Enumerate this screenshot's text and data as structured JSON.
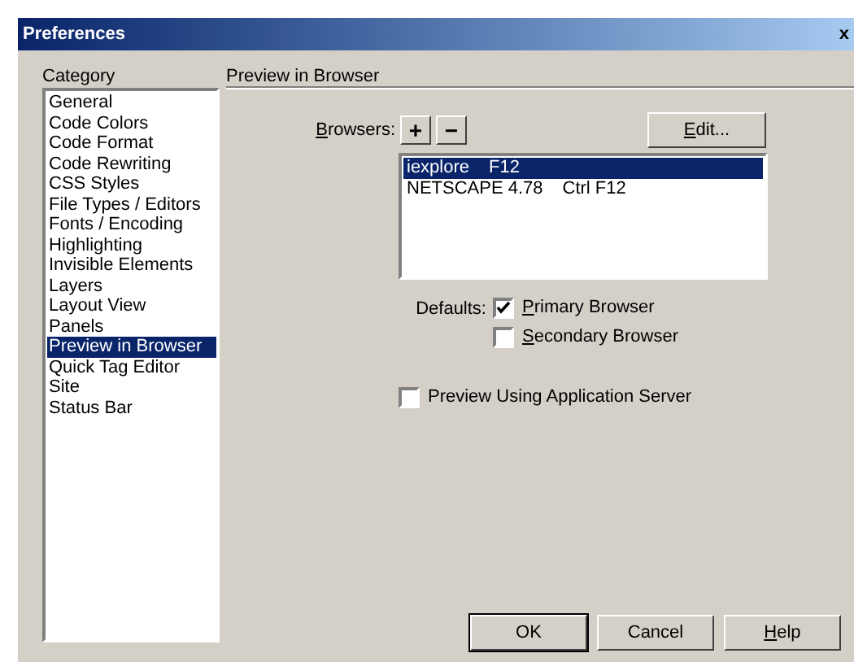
{
  "window": {
    "title": "Preferences",
    "close": "x"
  },
  "category": {
    "label": "Category",
    "items": [
      {
        "label": "General",
        "selected": false
      },
      {
        "label": "Code Colors",
        "selected": false
      },
      {
        "label": "Code Format",
        "selected": false
      },
      {
        "label": "Code Rewriting",
        "selected": false
      },
      {
        "label": "CSS Styles",
        "selected": false
      },
      {
        "label": "File Types / Editors",
        "selected": false
      },
      {
        "label": "Fonts / Encoding",
        "selected": false
      },
      {
        "label": "Highlighting",
        "selected": false
      },
      {
        "label": "Invisible Elements",
        "selected": false
      },
      {
        "label": "Layers",
        "selected": false
      },
      {
        "label": "Layout View",
        "selected": false
      },
      {
        "label": "Panels",
        "selected": false
      },
      {
        "label": "Preview in Browser",
        "selected": true
      },
      {
        "label": "Quick Tag Editor",
        "selected": false
      },
      {
        "label": "Site",
        "selected": false
      },
      {
        "label": "Status Bar",
        "selected": false
      }
    ]
  },
  "panel": {
    "title": "Preview in Browser",
    "browsers_label": {
      "text": "Browsers:",
      "mnemonic": true
    },
    "add_button": "+",
    "remove_button": "−",
    "edit_button": {
      "text": "Edit...",
      "mnemonic": true
    },
    "browsers": [
      {
        "name": "iexplore",
        "shortcut": "F12",
        "selected": true
      },
      {
        "name": "NETSCAPE 4.78",
        "shortcut": "Ctrl F12",
        "selected": false
      }
    ],
    "defaults_label": "Defaults:",
    "defaults": [
      {
        "label": "Primary Browser",
        "checked": true,
        "mnemonic": true
      },
      {
        "label": "Secondary Browser",
        "checked": false,
        "mnemonic": true
      }
    ],
    "app_server": {
      "label": "Preview Using Application Server",
      "checked": false
    }
  },
  "buttons": [
    {
      "text": "OK",
      "mnemonic": false
    },
    {
      "text": "Cancel",
      "mnemonic": false
    },
    {
      "text": "Help",
      "mnemonic": true
    }
  ]
}
